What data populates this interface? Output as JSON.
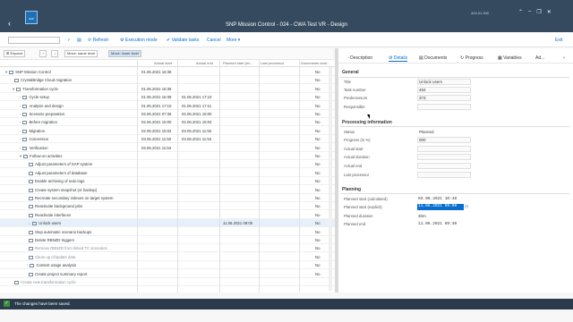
{
  "shell": {
    "title": "SNP Mission Control - 024 - CWA Test VR - Design",
    "right_info": "424.01.300",
    "caps": [
      "⌃",
      "–",
      "❐",
      "✕"
    ]
  },
  "toolbar": {
    "refresh": "Refresh",
    "execution_mode": "Execution mode",
    "validate": "Validate tasks",
    "cancel": "Cancel",
    "more": "More",
    "exit": "Exit"
  },
  "nav": {
    "expand": "Expand",
    "move_same": "Move: same level",
    "move_lower": "Move: lower level"
  },
  "tree": {
    "headers": [
      "Actual start",
      "Actual end",
      "Planned start (ex...",
      "Last processor",
      "Documents avai..."
    ],
    "rows": [
      {
        "label": "SNP Mission Control",
        "indent": 0,
        "arrow": "▾",
        "c1": "01.06.2021 16:38",
        "c2": "",
        "c3": "",
        "c4": "No"
      },
      {
        "label": "CrystalBridge Cloud migration",
        "indent": 1,
        "arrow": "",
        "c1": "",
        "c2": "",
        "c3": "",
        "c4": "No"
      },
      {
        "label": "Transformation cycle",
        "indent": 1,
        "arrow": "▾",
        "c1": "01.06.2021 16:38",
        "c2": "",
        "c3": "",
        "c4": "No"
      },
      {
        "label": "Cycle setup",
        "indent": 2,
        "arrow": "›",
        "c1": "01.06.2021 16:38",
        "c2": "01.06.2021 17:10",
        "c3": "",
        "c4": "No"
      },
      {
        "label": "Analysis and design",
        "indent": 2,
        "arrow": "›",
        "c1": "01.06.2021 17:10",
        "c2": "01.06.2021 17:11",
        "c3": "",
        "c4": "No"
      },
      {
        "label": "Scenario preparation",
        "indent": 2,
        "arrow": "›",
        "c1": "02.06.2021 07:35",
        "c2": "02.06.2021 15:00",
        "c3": "",
        "c4": "No"
      },
      {
        "label": "Before migration",
        "indent": 2,
        "arrow": "›",
        "c1": "02.06.2021 15:00",
        "c2": "02.06.2021 15:02",
        "c3": "",
        "c4": "No"
      },
      {
        "label": "Migration",
        "indent": 2,
        "arrow": "›",
        "c1": "02.06.2021 15:02",
        "c2": "03.06.2021 11:50",
        "c3": "",
        "c4": "No"
      },
      {
        "label": "Conversion",
        "indent": 2,
        "arrow": "›",
        "c1": "03.06.2021 11:50",
        "c2": "03.06.2021 11:53",
        "c3": "",
        "c4": "No"
      },
      {
        "label": "Verification",
        "indent": 2,
        "arrow": "›",
        "c1": "03.06.2021 11:53",
        "c2": "",
        "c3": "",
        "c4": "No"
      },
      {
        "label": "Follow-on activities",
        "indent": 2,
        "arrow": "▾",
        "c1": "",
        "c2": "",
        "c3": "",
        "c4": "No"
      },
      {
        "label": "Adjust parameters of SAP system",
        "indent": 3,
        "arrow": "",
        "c1": "",
        "c2": "",
        "c3": "",
        "c4": "No"
      },
      {
        "label": "Adjust parameters of database",
        "indent": 3,
        "arrow": "",
        "c1": "",
        "c2": "",
        "c3": "",
        "c4": "No"
      },
      {
        "label": "Enable archiving of redo logs",
        "indent": 3,
        "arrow": "",
        "c1": "",
        "c2": "",
        "c3": "",
        "c4": "No"
      },
      {
        "label": "Create system snapshot (or backup)",
        "indent": 3,
        "arrow": "",
        "c1": "",
        "c2": "",
        "c3": "",
        "c4": "No"
      },
      {
        "label": "Recreate secondary indexes on target system",
        "indent": 3,
        "arrow": "",
        "c1": "",
        "c2": "",
        "c3": "",
        "c4": "No"
      },
      {
        "label": "Reactivate background jobs",
        "indent": 3,
        "arrow": "",
        "c1": "",
        "c2": "",
        "c3": "",
        "c4": "No"
      },
      {
        "label": "Reactivate interfaces",
        "indent": 3,
        "arrow": "",
        "c1": "",
        "c2": "",
        "c3": "",
        "c4": "No"
      },
      {
        "label": "Unlock users",
        "indent": 3,
        "arrow": "→",
        "c1": "",
        "c2": "",
        "c3": "11.06.2021 09:00",
        "c4": "No",
        "selected": true
      },
      {
        "label": "Stop automatic scenario backups",
        "indent": 3,
        "arrow": "",
        "c1": "",
        "c2": "",
        "c3": "",
        "c4": "No"
      },
      {
        "label": "Delete RBNZD triggers",
        "indent": 3,
        "arrow": "",
        "c1": "",
        "c2": "",
        "c3": "",
        "c4": "No"
      },
      {
        "label": "Remove RBNZD from linked TC scenarios",
        "indent": 3,
        "arrow": "",
        "c1": "",
        "c2": "",
        "c3": "",
        "c4": "No",
        "muted": true
      },
      {
        "label": "Clean up cl/update data",
        "indent": 3,
        "arrow": "",
        "c1": "",
        "c2": "",
        "c3": "",
        "c4": "No",
        "muted": true
      },
      {
        "label": "Content usage analysis",
        "indent": 3,
        "arrow": "›",
        "c1": "",
        "c2": "",
        "c3": "",
        "c4": "No"
      },
      {
        "label": "Create project summary report",
        "indent": 3,
        "arrow": "",
        "c1": "",
        "c2": "",
        "c3": "",
        "c4": "No"
      },
      {
        "label": "Create new transformation cycle",
        "indent": 1,
        "arrow": "",
        "c1": "",
        "c2": "",
        "c3": "",
        "c4": "",
        "muted": true
      }
    ]
  },
  "tabs": [
    "Description",
    "Details",
    "Documents",
    "Progress",
    "Variables",
    "Ad..."
  ],
  "general": {
    "heading": "General",
    "fields": [
      {
        "label": "Title",
        "value": "Unlock users"
      },
      {
        "label": "Task number",
        "value": "494"
      },
      {
        "label": "Predecessors",
        "value": "373"
      },
      {
        "label": "Responsible",
        "value": ""
      }
    ]
  },
  "processing": {
    "heading": "Processing information",
    "fields": [
      {
        "label": "Status",
        "value": "Planned"
      },
      {
        "label": "Progress (in %)",
        "value": "000"
      },
      {
        "label": "Actual start",
        "value": ""
      },
      {
        "label": "Actual duration",
        "value": ""
      },
      {
        "label": "Actual end",
        "value": ""
      },
      {
        "label": "Last processor",
        "value": ""
      }
    ]
  },
  "planning": {
    "heading": "Planning",
    "fields": [
      {
        "label": "Planned start (calculated)",
        "value": "03.06.2021 10:48"
      },
      {
        "label": "Planned start (explicit)",
        "value": "11.06.2021 09:00"
      },
      {
        "label": "Planned duration",
        "value": "30m"
      },
      {
        "label": "Planned end",
        "value": "11.06.2021 09:30"
      }
    ]
  },
  "status": {
    "message": "The changes have been saved."
  }
}
